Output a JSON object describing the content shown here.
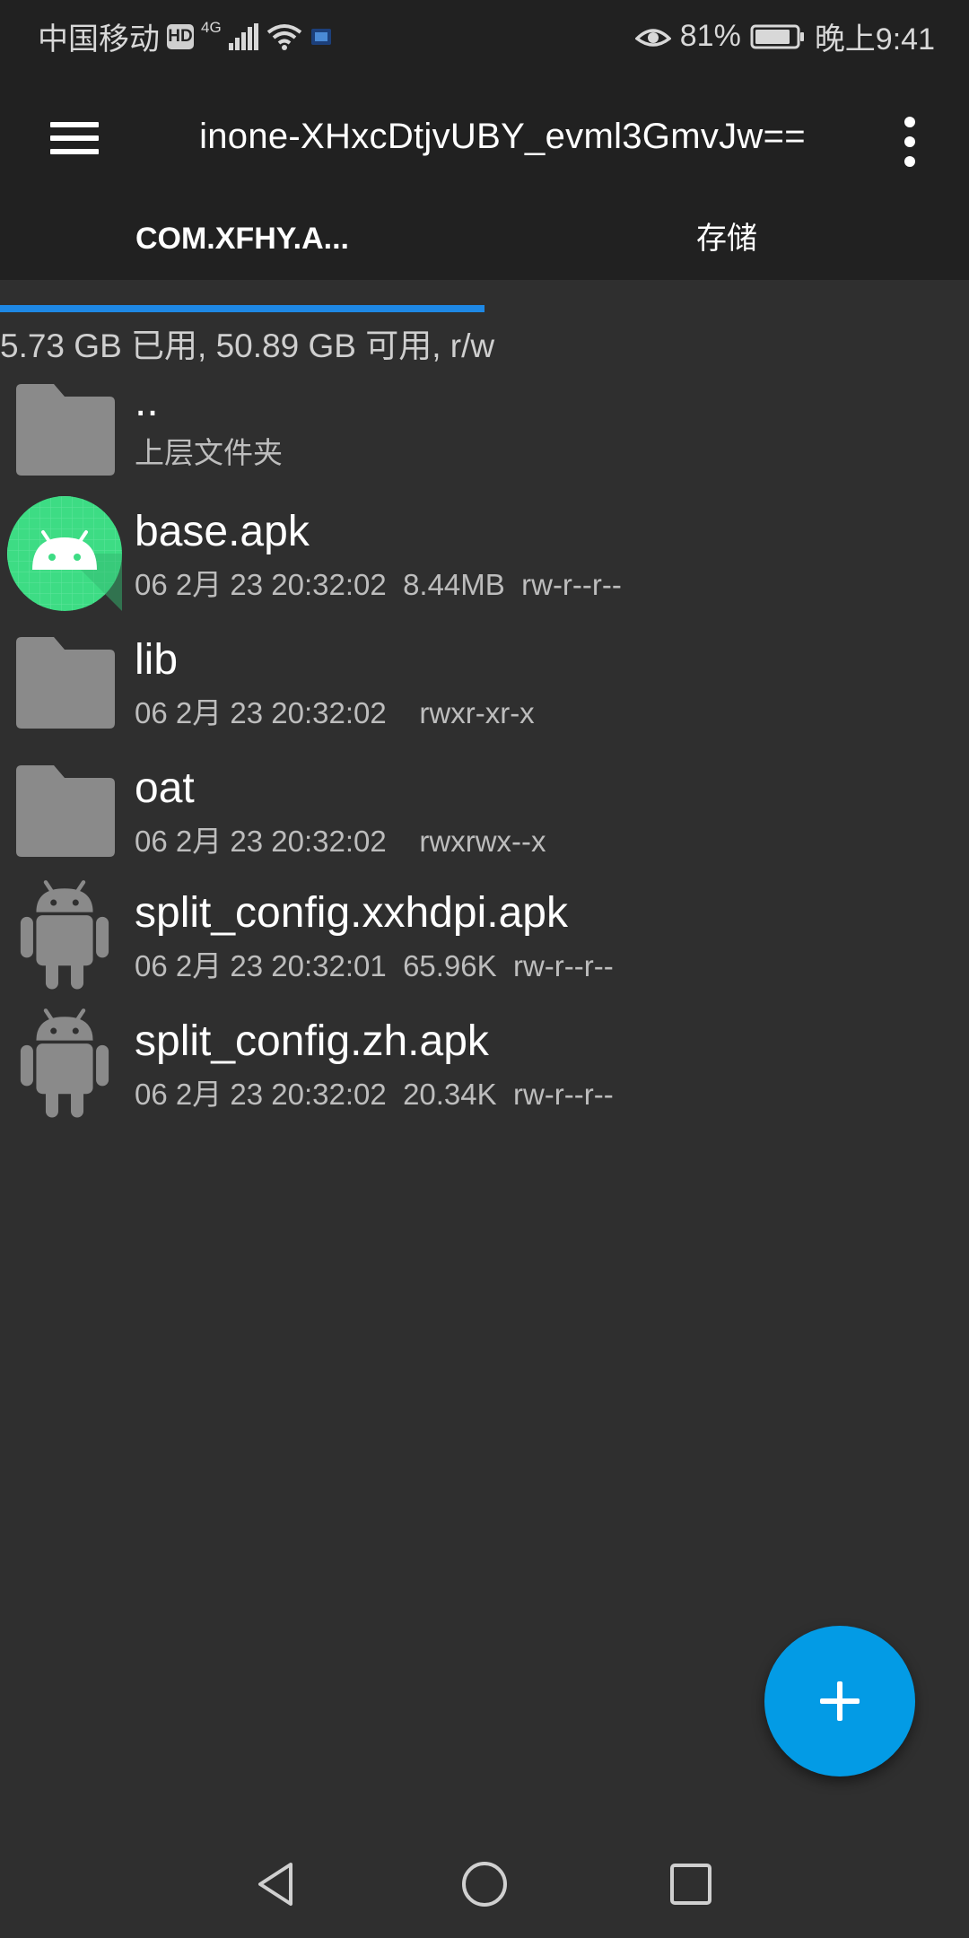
{
  "status_bar": {
    "carrier": "中国移动",
    "hd": "HD",
    "network": "4G",
    "battery": "81%",
    "time": "晚上9:41",
    "icons": [
      "hd-badge-icon",
      "signal-icon",
      "wifi-icon",
      "notification-icon",
      "eye-icon",
      "battery-icon"
    ]
  },
  "app_bar": {
    "title": "inone-XHxcDtjvUBY_evml3GmvJw==",
    "menu_icon": "hamburger-menu-icon",
    "more_icon": "more-vert-icon"
  },
  "tabs": [
    {
      "label": "COM.XFHY.A...",
      "active": true
    },
    {
      "label": "存储",
      "active": false
    }
  ],
  "storage_info": "5.73 GB 已用, 50.89 GB 可用, r/w",
  "files": [
    {
      "name": "..",
      "meta": "上层文件夹",
      "icon": "folder-icon"
    },
    {
      "name": "base.apk",
      "meta": "06 2月 23 20:32:02  8.44MB  rw-r--r--",
      "icon": "android-app-icon"
    },
    {
      "name": "lib",
      "meta": "06 2月 23 20:32:02    rwxr-xr-x",
      "icon": "folder-icon"
    },
    {
      "name": "oat",
      "meta": "06 2月 23 20:32:02    rwxrwx--x",
      "icon": "folder-icon"
    },
    {
      "name": "split_config.xxhdpi.apk",
      "meta": "06 2月 23 20:32:01  65.96K  rw-r--r--",
      "icon": "android-robot-icon"
    },
    {
      "name": "split_config.zh.apk",
      "meta": "06 2月 23 20:32:02  20.34K  rw-r--r--",
      "icon": "android-robot-icon"
    }
  ],
  "fab": {
    "icon": "plus-icon"
  },
  "nav_bar": {
    "icons": [
      "back-icon",
      "home-icon",
      "recents-icon"
    ]
  },
  "colors": {
    "background": "#2f2f2f",
    "app_bar": "#212121",
    "accent": "#1e88e5",
    "fab": "#039be5",
    "icon_gray": "#8a8a8a",
    "android_green": "#3ddc84"
  }
}
